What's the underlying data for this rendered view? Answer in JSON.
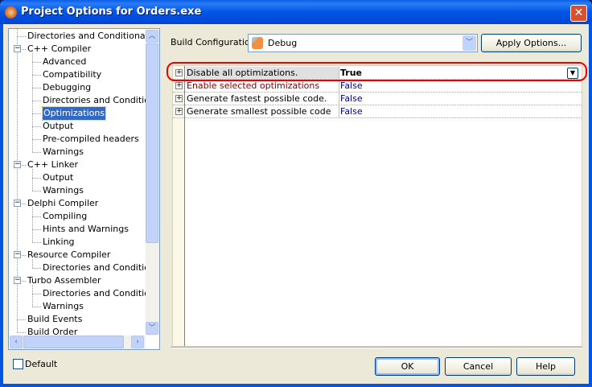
{
  "window": {
    "title": "Project Options for Orders.exe",
    "close_icon": "close-icon"
  },
  "tree": {
    "items": [
      {
        "label": "Directories and Conditionals",
        "level": 0
      },
      {
        "label": "C++ Compiler",
        "level": 0,
        "expanded": true
      },
      {
        "label": "Advanced",
        "level": 1
      },
      {
        "label": "Compatibility",
        "level": 1
      },
      {
        "label": "Debugging",
        "level": 1
      },
      {
        "label": "Directories and Conditionals",
        "level": 1
      },
      {
        "label": "Optimizations",
        "level": 1,
        "selected": true
      },
      {
        "label": "Output",
        "level": 1
      },
      {
        "label": "Pre-compiled headers",
        "level": 1
      },
      {
        "label": "Warnings",
        "level": 1
      },
      {
        "label": "C++ Linker",
        "level": 0,
        "expanded": true
      },
      {
        "label": "Output",
        "level": 1
      },
      {
        "label": "Warnings",
        "level": 1
      },
      {
        "label": "Delphi Compiler",
        "level": 0,
        "expanded": true
      },
      {
        "label": "Compiling",
        "level": 1
      },
      {
        "label": "Hints and Warnings",
        "level": 1
      },
      {
        "label": "Linking",
        "level": 1
      },
      {
        "label": "Resource Compiler",
        "level": 0,
        "expanded": true
      },
      {
        "label": "Directories and Conditionals",
        "level": 1
      },
      {
        "label": "Turbo Assembler",
        "level": 0,
        "expanded": true
      },
      {
        "label": "Directories and Conditionals",
        "level": 1
      },
      {
        "label": "Warnings",
        "level": 1
      },
      {
        "label": "Build Events",
        "level": 0
      },
      {
        "label": "Build Order",
        "level": 0
      }
    ]
  },
  "build": {
    "label": "Build Configuration",
    "value": "Debug",
    "apply_label": "Apply Options..."
  },
  "properties": [
    {
      "name": "Disable all optimizations.",
      "value": "True",
      "current": true
    },
    {
      "name": "Enable selected optimizations",
      "value": "False",
      "modified": true
    },
    {
      "name": "Generate fastest possible code.",
      "value": "False"
    },
    {
      "name": "Generate smallest possible code",
      "value": "False"
    }
  ],
  "footer": {
    "default_label": "Default",
    "default_checked": false,
    "ok": "OK",
    "cancel": "Cancel",
    "help": "Help"
  },
  "colors": {
    "modified_name": "#800000",
    "value_text": "#000080",
    "highlight": "#e00000",
    "selection": "#316ac5"
  }
}
